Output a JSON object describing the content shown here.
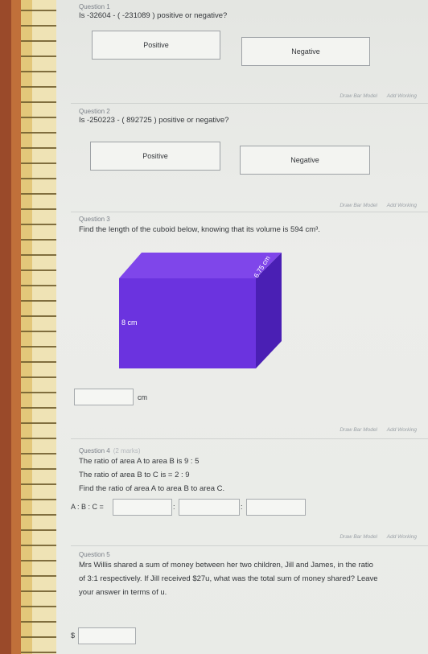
{
  "q1": {
    "heading": "Question 1",
    "text": "Is -32604 - ( -231089 ) positive or negative?",
    "option_a": "Positive",
    "option_b": "Negative",
    "tool_a": "Draw Bar Model",
    "tool_b": "Add Working"
  },
  "q2": {
    "heading": "Question 2",
    "text": "Is -250223 - ( 892725 ) positive or negative?",
    "option_a": "Positive",
    "option_b": "Negative",
    "tool_a": "Draw Bar Model",
    "tool_b": "Add Working"
  },
  "q3": {
    "heading": "Question 3",
    "text": "Find the length of the cuboid below, knowing that its volume is 594 cm³.",
    "label_height": "8 cm",
    "label_depth": "6.75 cm",
    "unit": "cm",
    "tool_a": "Draw Bar Model",
    "tool_b": "Add Working",
    "colors": {
      "front": "#6b33df",
      "top": "#7f46ea",
      "side": "#4a1fb4"
    }
  },
  "q4": {
    "heading": "Question 4",
    "marks": "(2 marks)",
    "line1": "The ratio of area A to area B is 9 : 5",
    "line2": "The ratio of area B to C is = 2 : 9",
    "line3": "Find the ratio of area A to area B to area C.",
    "ratio_label": "A : B : C =",
    "sep": ":",
    "tool_a": "Draw Bar Model",
    "tool_b": "Add Working"
  },
  "q5": {
    "heading": "Question 5",
    "line1": "Mrs Willis shared a sum of money between her two children, Jill and James, in the ratio",
    "line2": "of 3:1 respectively. If Jill received $27u, what was the total sum of money shared? Leave",
    "line3": "your answer in terms of u.",
    "currency": "$"
  }
}
